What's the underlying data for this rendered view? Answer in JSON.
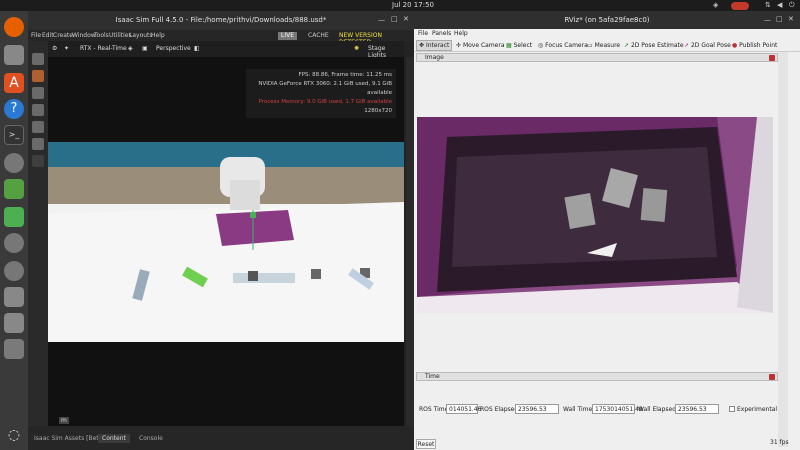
{
  "system": {
    "clock": "Jul 20  17:50"
  },
  "isaac": {
    "title": "Isaac Sim Full 4.5.0 - File:/home/prithvi/Downloads/888.usd*",
    "menu": [
      "File",
      "Edit",
      "Create",
      "Window",
      "Tools",
      "Utilities",
      "Layouts",
      "Help"
    ],
    "live_label": "LIVE",
    "cache_label": "CACHE",
    "new_version": "NEW VERSION DETECTED",
    "viewport_toolbar": {
      "renderer": "RTX - Real-Time",
      "camera": "Perspective",
      "lights": "Stage Lights"
    },
    "stats": {
      "fps_line": "FPS: 88.86, Frame time: 11.25 ms",
      "gpu_line": "NVIDIA GeForce RTX 3060: 2.1 GiB used, 9.1 GiB available",
      "process_line": "Process Memory: 9.0 GiB used, 1.7 GiB available",
      "resolution": "1280x720"
    },
    "axis_label": "m",
    "bottom_tabs": [
      "Isaac Sim Assets [Beta]",
      "Content",
      "Console"
    ],
    "active_tab": "Content"
  },
  "rviz": {
    "title": "RViz* (on 5afa29fae8c0)",
    "menu": [
      "File",
      "Panels",
      "Help"
    ],
    "toolbar": [
      "Interact",
      "Move Camera",
      "Select",
      "Focus Camera",
      "Measure",
      "2D Pose Estimate",
      "2D Goal Pose",
      "Publish Point"
    ],
    "image_panel_title": "Image",
    "time_panel_title": "Time",
    "time": {
      "ros_time_label": "ROS Time:",
      "ros_time": "014051.46",
      "ros_elapsed_label": "ROS Elapsed:",
      "ros_elapsed": "23596.53",
      "wall_time_label": "Wall Time:",
      "wall_time": "1753014051.49",
      "wall_elapsed_label": "Wall Elapsed:",
      "wall_elapsed": "23596.53",
      "experimental_label": "Experimental"
    },
    "reset_label": "Reset",
    "fps": "31 fps"
  },
  "colors": {
    "accent_purple": "#8a3a82",
    "live_yellow": "#f0e040",
    "close_red": "#c03030"
  }
}
